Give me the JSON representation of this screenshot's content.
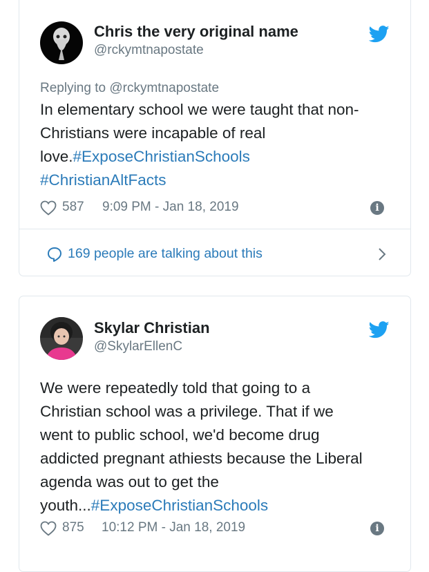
{
  "tweets": [
    {
      "author_name": "Chris the very original name",
      "author_handle": "@rckymtnapostate",
      "replying_to": "Replying to @rckymtnapostate",
      "text_lines": [
        [
          {
            "t": "In elementary school we were taught that non-",
            "tag": false
          }
        ],
        [
          {
            "t": "Christians were incapable of real",
            "tag": false
          }
        ],
        [
          {
            "t": "love.",
            "tag": false
          },
          {
            "t": "#ExposeChristianSchools",
            "tag": true
          }
        ],
        [
          {
            "t": "#ChristianAltFacts",
            "tag": true
          }
        ]
      ],
      "likes": "587",
      "timestamp": "9:09 PM - Jan 18, 2019",
      "talking": "169 people are talking about this"
    },
    {
      "author_name": "Skylar Christian",
      "author_handle": "@SkylarEllenC",
      "text_lines": [
        [
          {
            "t": "We were repeatedly told that going to a",
            "tag": false
          }
        ],
        [
          {
            "t": "Christian school was a privilege. That if we",
            "tag": false
          }
        ],
        [
          {
            "t": "went to public school, we'd become drug",
            "tag": false
          }
        ],
        [
          {
            "t": "addicted pregnant athiests because the Liberal",
            "tag": false
          }
        ],
        [
          {
            "t": "agenda was out to get the",
            "tag": false
          }
        ],
        [
          {
            "t": "youth...",
            "tag": false
          },
          {
            "t": "#ExposeChristianSchools",
            "tag": true
          }
        ]
      ],
      "likes": "875",
      "timestamp": "10:12 PM - Jan 18, 2019"
    }
  ],
  "colors": {
    "link": "#2b7bb9",
    "muted": "#697882",
    "text": "#1c2022",
    "border": "#e1e8ed",
    "twitter_blue": "#1da1f2"
  },
  "icons": [
    "twitter-bird-icon",
    "heart-icon",
    "info-icon",
    "speech-bubble-icon",
    "chevron-right-icon"
  ]
}
